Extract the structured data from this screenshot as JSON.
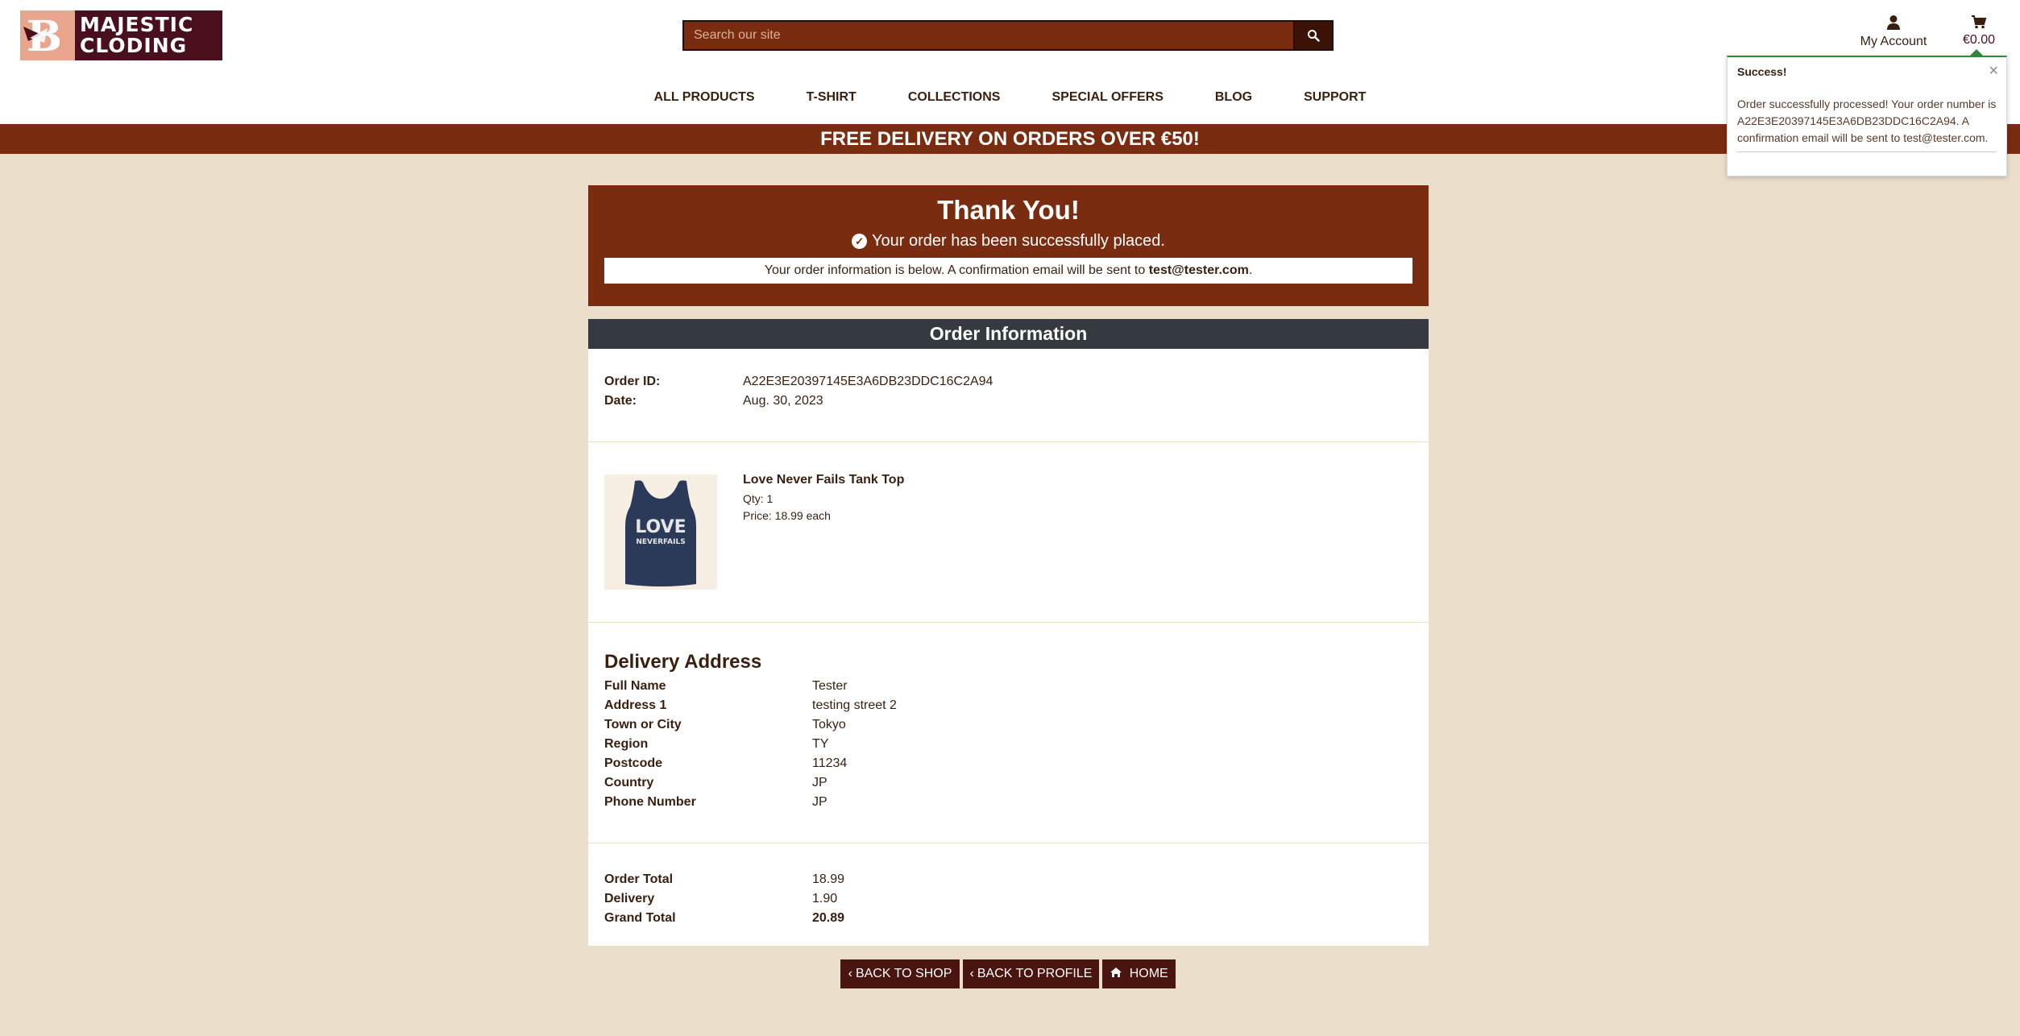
{
  "brand": {
    "line1": "MAJESTIC",
    "line2": "CLODING"
  },
  "search": {
    "placeholder": "Search our site"
  },
  "account": {
    "label": "My Account"
  },
  "cart": {
    "total": "€0.00"
  },
  "nav": [
    "ALL PRODUCTS",
    "T-SHIRT",
    "COLLECTIONS",
    "SPECIAL OFFERS",
    "BLOG",
    "SUPPORT"
  ],
  "banner": "FREE DELIVERY ON ORDERS OVER €50!",
  "toast": {
    "title": "Success!",
    "close": "×",
    "message": "Order successfully processed! Your order number is A22E3E20397145E3A6DB23DDC16C2A94. A confirmation email will be sent to test@tester.com."
  },
  "thanks": {
    "title": "Thank You!",
    "placed": "Your order has been successfully placed.",
    "info_prefix": "Your order information is below. A confirmation email will be sent to ",
    "email": "test@tester.com",
    "info_suffix": "."
  },
  "order_info": {
    "header": "Order Information",
    "id_label": "Order ID:",
    "id_value": "A22E3E20397145E3A6DB23DDC16C2A94",
    "date_label": "Date:",
    "date_value": "Aug. 30, 2023"
  },
  "product": {
    "name": "Love Never Fails Tank Top",
    "qty": "Qty: 1",
    "price": "Price: 18.99 each",
    "shirt_text_1": "LOVE",
    "shirt_text_2": "NEVERFAILS"
  },
  "delivery": {
    "title": "Delivery Address",
    "rows": [
      {
        "label": "Full Name",
        "value": "Tester"
      },
      {
        "label": "Address 1",
        "value": "testing street 2"
      },
      {
        "label": "Town or City",
        "value": "Tokyo"
      },
      {
        "label": "Region",
        "value": "TY"
      },
      {
        "label": "Postcode",
        "value": "11234"
      },
      {
        "label": "Country",
        "value": "JP"
      },
      {
        "label": "Phone Number",
        "value": "JP"
      }
    ]
  },
  "totals": {
    "rows": [
      {
        "label": "Order Total",
        "value": "18.99"
      },
      {
        "label": "Delivery",
        "value": "1.90"
      },
      {
        "label": "Grand Total",
        "value": "20.89"
      }
    ]
  },
  "buttons": {
    "back_shop": "BACK TO SHOP",
    "back_profile": "BACK TO PROFILE",
    "home": "HOME"
  },
  "colors": {
    "brand_rust": "#7a2c10",
    "dark_maroon": "#4a0f1c",
    "page_bg": "#ebdfcc",
    "header_dark": "#343a40",
    "toast_accent": "#2e8b3a"
  }
}
